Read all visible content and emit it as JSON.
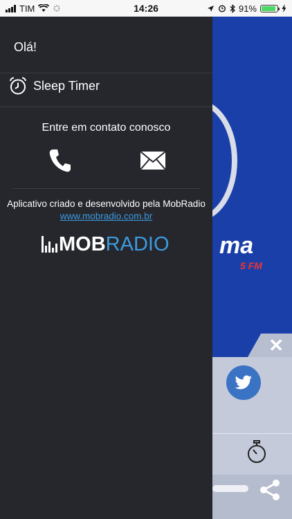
{
  "status_bar": {
    "carrier": "TIM",
    "time": "14:26",
    "battery_percent": "91%",
    "battery_level": 0.91,
    "icons": [
      "signal-icon",
      "wifi-icon",
      "activity-spinner-icon",
      "location-icon",
      "alarm-icon",
      "bluetooth-icon",
      "battery-icon",
      "charging-icon"
    ]
  },
  "drawer": {
    "greeting": "Olá!",
    "sleep_timer_label": "Sleep Timer",
    "contact_title": "Entre em contato conosco",
    "credit_text": "Aplicativo criado e desenvolvido pela MobRadio",
    "credit_link": "www.mobradio.com.br",
    "logo": {
      "mob": "MOB",
      "radio": "RADIO"
    },
    "colors": {
      "background": "#25272d",
      "link": "#3d9be0"
    }
  },
  "background_app": {
    "logo_text": "ma",
    "logo_fm": "5 FM",
    "colors": {
      "brand_blue": "#1b3fa8",
      "panel": "#c4cad9",
      "twitter": "#3b73c4"
    }
  }
}
